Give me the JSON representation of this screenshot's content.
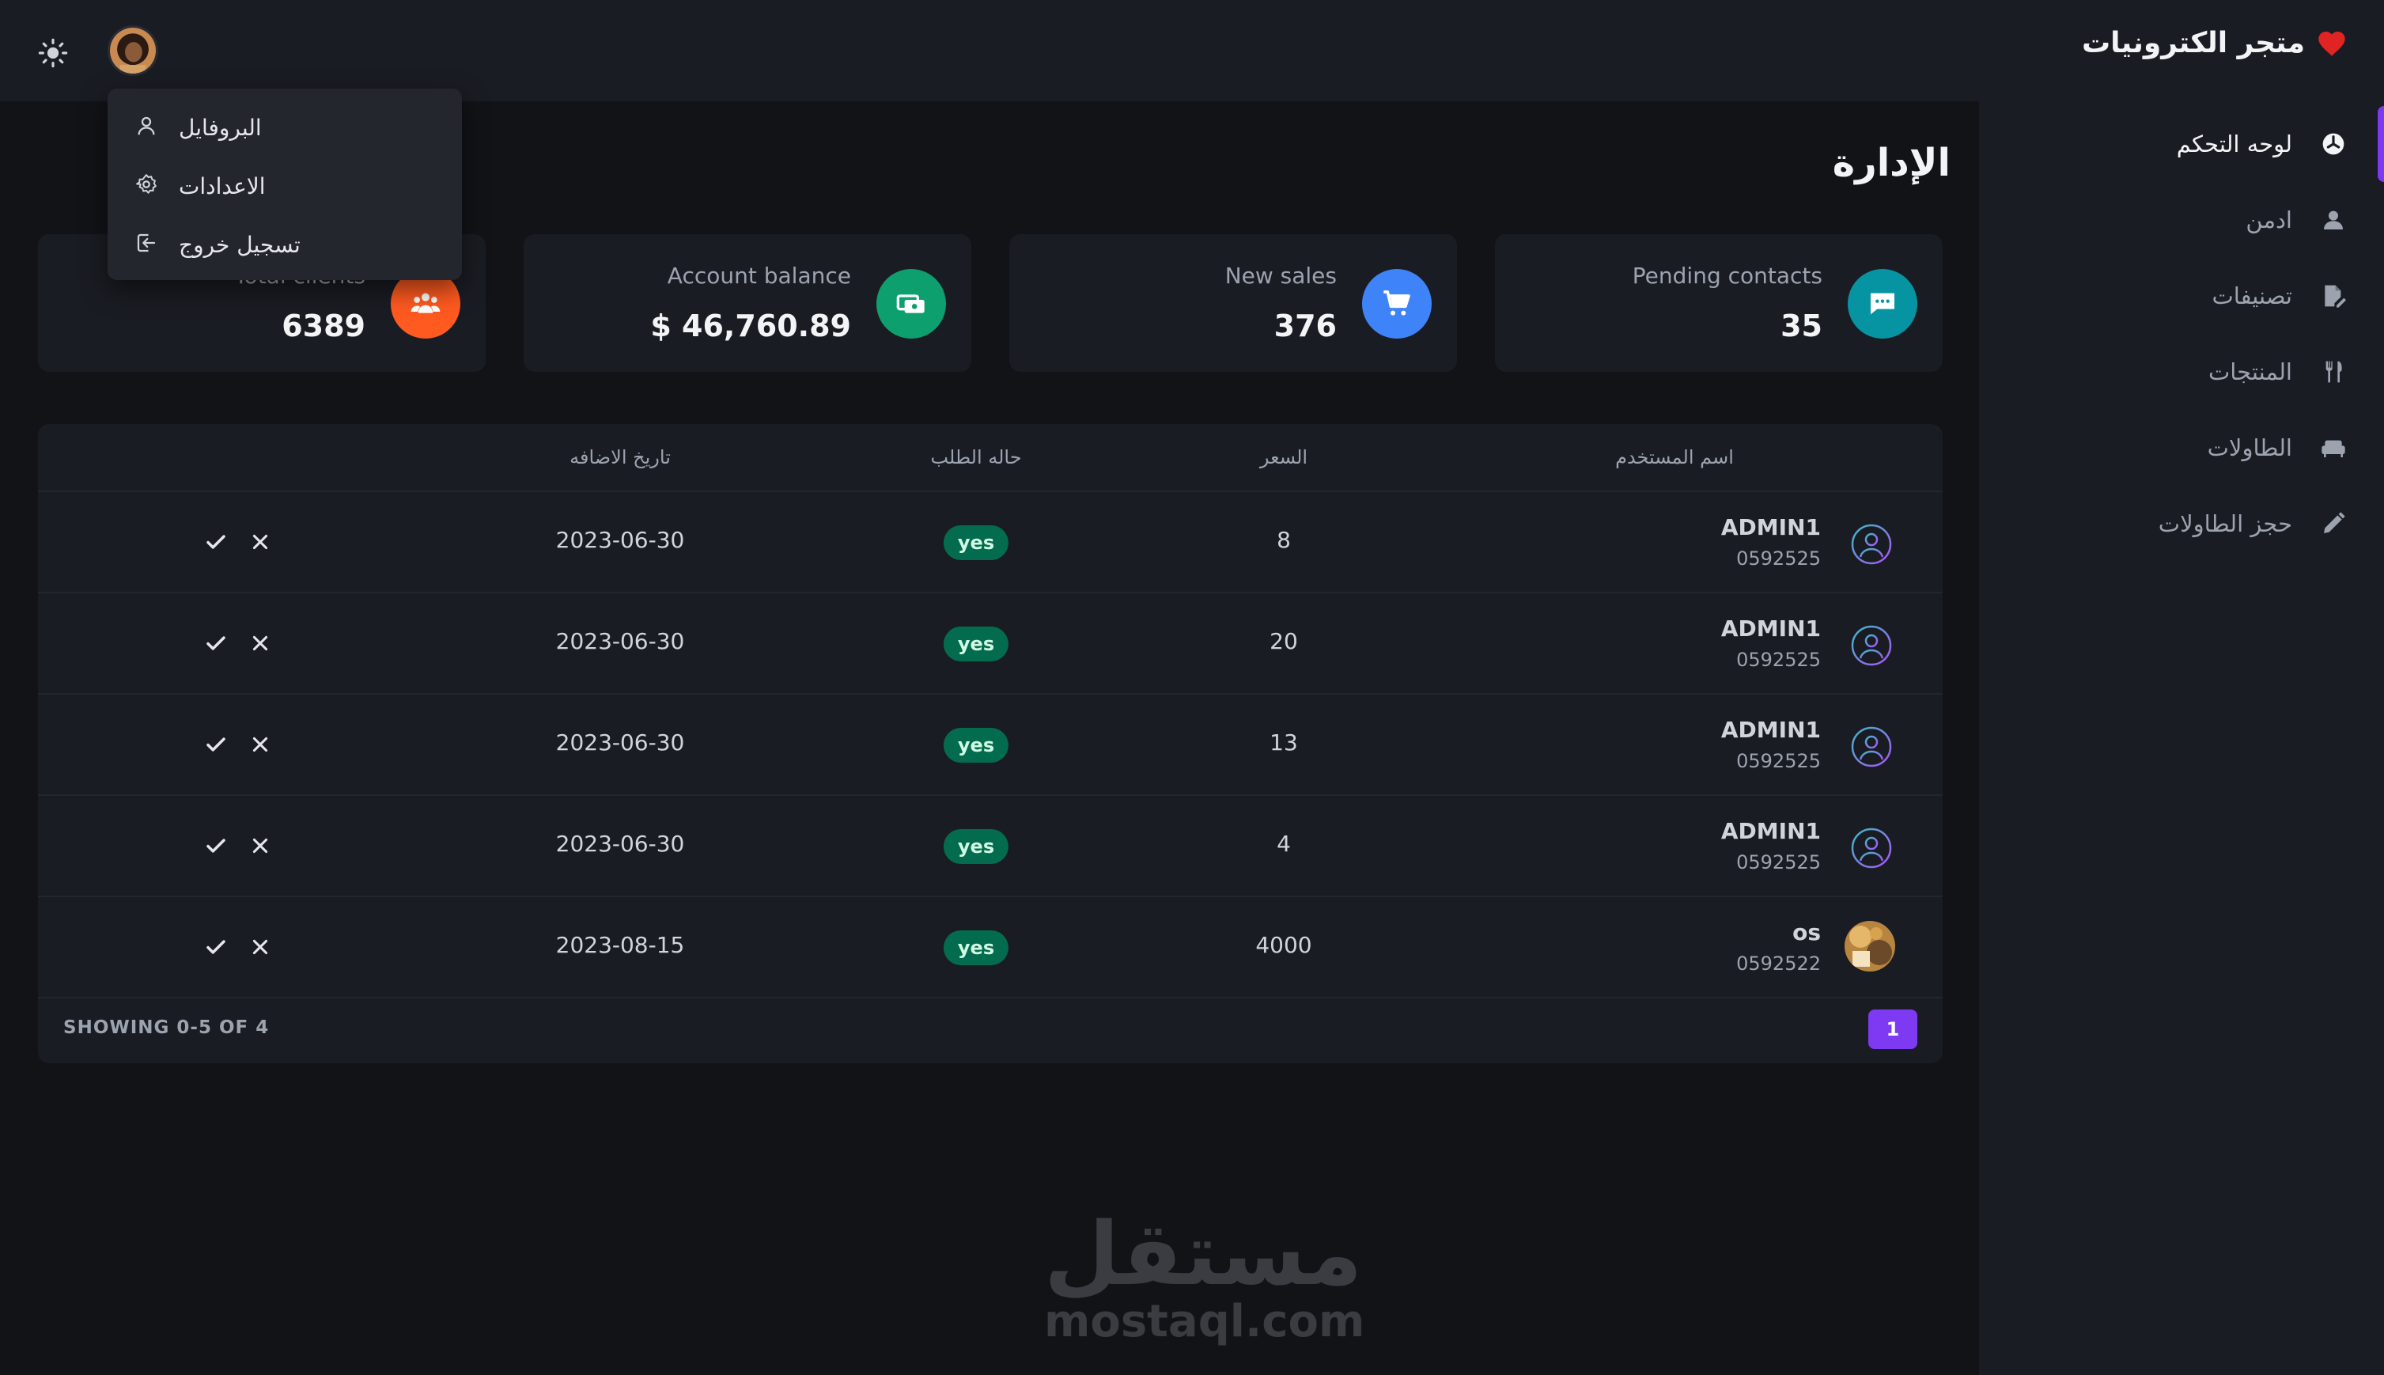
{
  "sidebar": {
    "brand": "متجر الكترونيات",
    "items": [
      {
        "label": "لوحه التحكم",
        "icon": "dashboard-icon",
        "active": true
      },
      {
        "label": "ادمن",
        "icon": "user-icon",
        "active": false
      },
      {
        "label": "تصنيفات",
        "icon": "file-edit-icon",
        "active": false
      },
      {
        "label": "المنتجات",
        "icon": "utensils-icon",
        "active": false
      },
      {
        "label": "الطاولات",
        "icon": "sofa-icon",
        "active": false
      },
      {
        "label": "حجز الطاولات",
        "icon": "pencil-icon",
        "active": false
      }
    ]
  },
  "header": {
    "theme_icon": "sun-icon",
    "avatar_icon": "user-avatar-photo"
  },
  "dropdown": {
    "items": [
      {
        "label": "البروفايل",
        "icon": "user-outline-icon"
      },
      {
        "label": "الاعدادات",
        "icon": "gear-icon"
      },
      {
        "label": "تسجيل خروج",
        "icon": "logout-icon"
      }
    ]
  },
  "page": {
    "title": "الإدارة"
  },
  "cards": [
    {
      "label": "Pending contacts",
      "value": "35",
      "icon": "chat-icon",
      "color": "#0694a2"
    },
    {
      "label": "New sales",
      "value": "376",
      "icon": "cart-icon",
      "color": "#3f83f8"
    },
    {
      "label": "Account balance",
      "value": "$ 46,760.89",
      "icon": "money-icon",
      "color": "#0e9f6e"
    },
    {
      "label": "Total clients",
      "value": "6389",
      "icon": "users-icon",
      "color": "#ff5a1f"
    }
  ],
  "table": {
    "headers": [
      "اسم المستخدم",
      "السعر",
      "حاله الطلب",
      "تاريخ الاضافه"
    ],
    "rows": [
      {
        "name": "ADMIN1",
        "phone": "0592525",
        "price": "8",
        "status": "yes",
        "date": "2023-06-30",
        "avatar": "user-outline-avatar"
      },
      {
        "name": "ADMIN1",
        "phone": "0592525",
        "price": "20",
        "status": "yes",
        "date": "2023-06-30",
        "avatar": "user-outline-avatar"
      },
      {
        "name": "ADMIN1",
        "phone": "0592525",
        "price": "13",
        "status": "yes",
        "date": "2023-06-30",
        "avatar": "user-outline-avatar"
      },
      {
        "name": "ADMIN1",
        "phone": "0592525",
        "price": "4",
        "status": "yes",
        "date": "2023-06-30",
        "avatar": "user-outline-avatar"
      },
      {
        "name": "os",
        "phone": "0592522",
        "price": "4000",
        "status": "yes",
        "date": "2023-08-15",
        "avatar": "user-photo-avatar"
      }
    ],
    "footer": {
      "showing": "SHOWING 0-5 OF 4",
      "page": "1"
    }
  },
  "watermark": {
    "arabic": "مستقل",
    "latin": "mostaql.com"
  },
  "colors": {
    "accent": "#7e3af2",
    "status_green": "#046c4e",
    "brand_heart": "#e02424"
  }
}
